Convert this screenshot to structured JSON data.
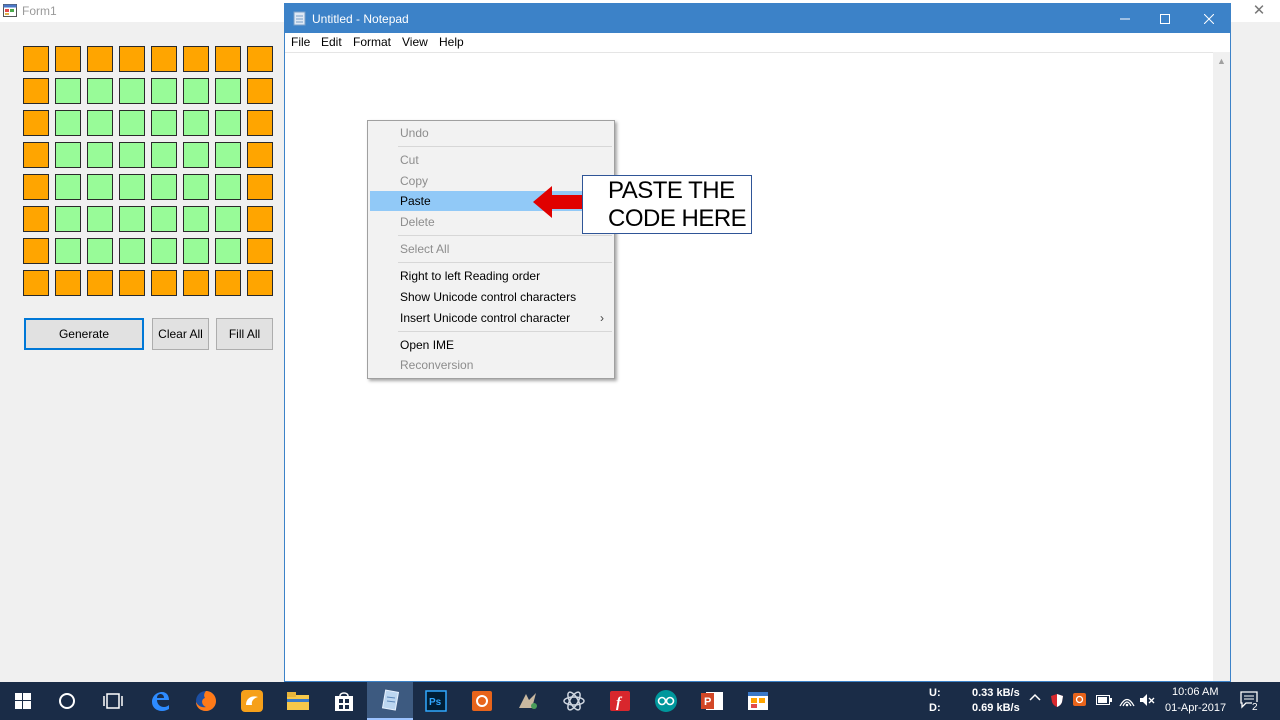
{
  "form1": {
    "title": "Form1",
    "grid": [
      [
        "o",
        "o",
        "o",
        "o",
        "o",
        "o",
        "o",
        "o"
      ],
      [
        "o",
        "g",
        "g",
        "g",
        "g",
        "g",
        "g",
        "o"
      ],
      [
        "o",
        "g",
        "g",
        "g",
        "g",
        "g",
        "g",
        "o"
      ],
      [
        "o",
        "g",
        "g",
        "g",
        "g",
        "g",
        "g",
        "o"
      ],
      [
        "o",
        "g",
        "g",
        "g",
        "g",
        "g",
        "g",
        "o"
      ],
      [
        "o",
        "g",
        "g",
        "g",
        "g",
        "g",
        "g",
        "o"
      ],
      [
        "o",
        "g",
        "g",
        "g",
        "g",
        "g",
        "g",
        "o"
      ],
      [
        "o",
        "o",
        "o",
        "o",
        "o",
        "o",
        "o",
        "o"
      ]
    ],
    "colors": {
      "o": "#ffa500",
      "g": "#98fb98"
    },
    "buttons": {
      "generate": "Generate",
      "clear_all": "Clear All",
      "fill_all": "Fill All"
    }
  },
  "notepad": {
    "title": "Untitled - Notepad",
    "menu": [
      "File",
      "Edit",
      "Format",
      "View",
      "Help"
    ],
    "accent": "#3c82c8"
  },
  "context_menu": {
    "items": [
      {
        "label": "Undo",
        "disabled": true
      },
      {
        "label": "Cut",
        "disabled": true
      },
      {
        "label": "Copy",
        "disabled": true
      },
      {
        "label": "Paste",
        "disabled": false,
        "highlighted": true
      },
      {
        "label": "Delete",
        "disabled": true
      },
      {
        "label": "Select All",
        "disabled": true
      },
      {
        "label": "Right to left Reading order",
        "disabled": false
      },
      {
        "label": "Show Unicode control characters",
        "disabled": false
      },
      {
        "label": "Insert Unicode control character",
        "disabled": false,
        "submenu": true
      },
      {
        "label": "Open IME",
        "disabled": false
      },
      {
        "label": "Reconversion",
        "disabled": true
      }
    ],
    "submenu_glyph": "›"
  },
  "annotation": {
    "line1": "PASTE THE",
    "line2": "CODE HERE",
    "arrow_color": "#e00000"
  },
  "taskbar": {
    "net_upload_label": "U:",
    "net_download_label": "D:",
    "net_upload": "0.33 kB/s",
    "net_download": "0.69 kB/s",
    "time": "10:06 AM",
    "date": "01-Apr-2017",
    "notification_count": "2"
  }
}
